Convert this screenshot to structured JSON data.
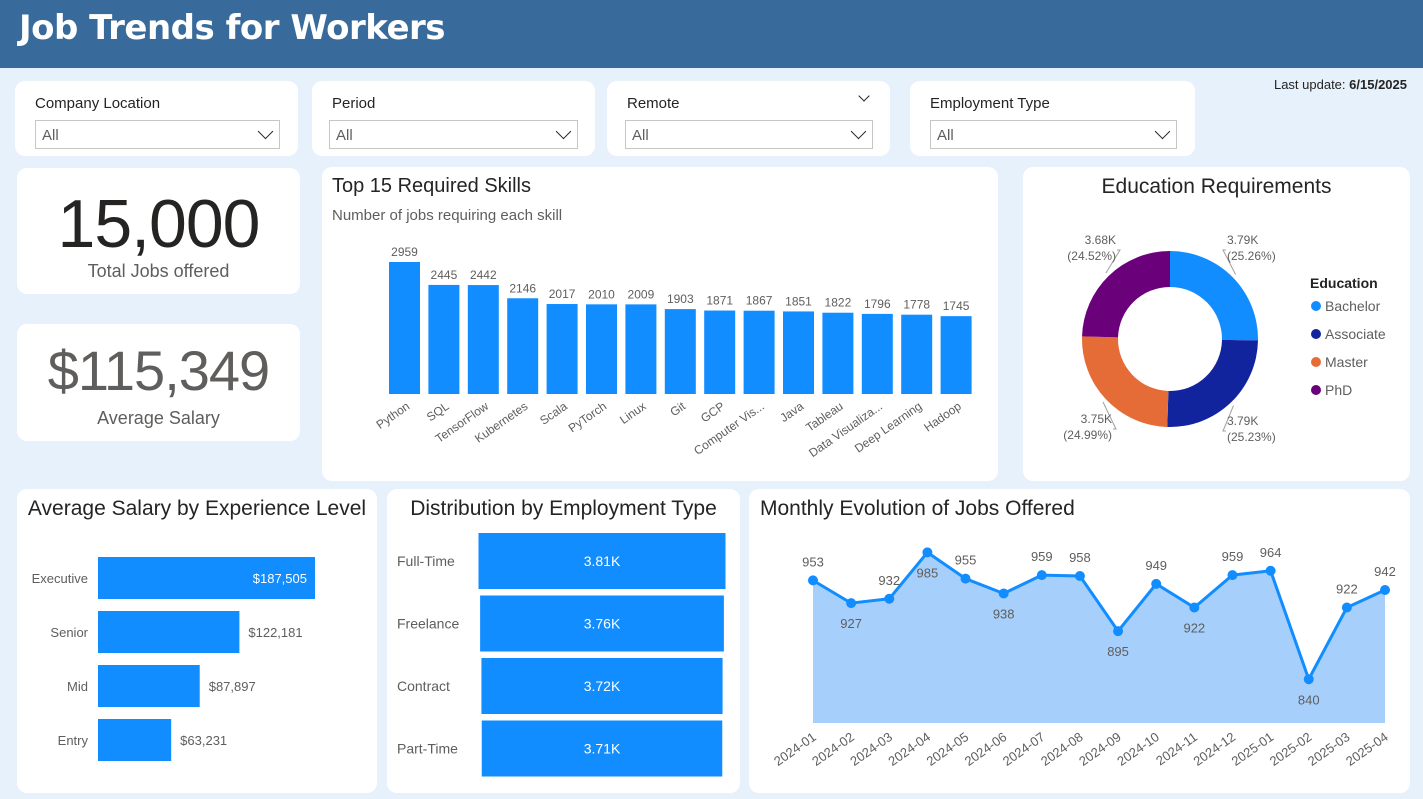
{
  "header": {
    "title": "Job Trends for Workers"
  },
  "last_update": {
    "label": "Last update:",
    "value": "6/15/2025"
  },
  "slicers": [
    {
      "title": "Company Location",
      "value": "All"
    },
    {
      "title": "Period",
      "value": "All"
    },
    {
      "title": "Remote",
      "value": "All"
    },
    {
      "title": "Employment Type",
      "value": "All"
    }
  ],
  "kpis": {
    "total_jobs": {
      "value": "15,000",
      "label": "Total Jobs offered"
    },
    "avg_salary": {
      "value": "$115,349",
      "label": "Average Salary"
    }
  },
  "skills_chart": {
    "title": "Top 15 Required Skills",
    "subtitle": "Number of jobs requiring each skill"
  },
  "education_chart": {
    "title": "Education Requirements",
    "legend_title": "Education"
  },
  "experience_chart": {
    "title": "Average Salary by Experience Level"
  },
  "employment_chart": {
    "title": "Distribution by Employment Type"
  },
  "monthly_chart": {
    "title": "Monthly Evolution of Jobs Offered"
  },
  "colors": {
    "header": "#386b9b",
    "accent": "#118dff",
    "area": "#a6cffb",
    "associate": "#12239e",
    "master": "#e66c37",
    "phd": "#6b007b"
  },
  "chart_data": [
    {
      "type": "bar",
      "title": "Top 15 Required Skills",
      "subtitle": "Number of jobs requiring each skill",
      "categories": [
        "Python",
        "SQL",
        "TensorFlow",
        "Kubernetes",
        "Scala",
        "PyTorch",
        "Linux",
        "Git",
        "GCP",
        "Computer Vis...",
        "Java",
        "Tableau",
        "Data Visualiza...",
        "Deep Learning",
        "Hadoop"
      ],
      "values": [
        2959,
        2445,
        2442,
        2146,
        2017,
        2010,
        2009,
        1903,
        1871,
        1867,
        1851,
        1822,
        1796,
        1778,
        1745
      ],
      "data_labels": [
        "2959",
        "2445",
        "2442",
        "2146",
        "2017",
        "2010",
        "2009",
        "1903",
        "1871",
        "1867",
        "1851",
        "1822",
        "1796",
        "1778",
        "1745"
      ],
      "ylim": [
        0,
        3000
      ]
    },
    {
      "type": "pie",
      "title": "Education Requirements",
      "legend_title": "Education",
      "legend_position": "right",
      "categories": [
        "Bachelor",
        "Associate",
        "Master",
        "PhD"
      ],
      "values": [
        3790,
        3785,
        3749,
        3678
      ],
      "percents": [
        25.26,
        25.23,
        24.99,
        24.52
      ],
      "labels": [
        [
          "3.79K",
          "(25.26%)"
        ],
        [
          "3.79K",
          "(25.23%)"
        ],
        [
          "3.75K",
          "(24.99%)"
        ],
        [
          "3.68K",
          "(24.52%)"
        ]
      ],
      "colors": [
        "#118dff",
        "#12239e",
        "#e66c37",
        "#6b007b"
      ]
    },
    {
      "type": "bar",
      "orientation": "horizontal",
      "title": "Average Salary by Experience Level",
      "categories": [
        "Executive",
        "Senior",
        "Mid",
        "Entry"
      ],
      "values": [
        187505,
        122181,
        87897,
        63231
      ],
      "data_labels": [
        "$187,505",
        "$122,181",
        "$87,897",
        "$63,231"
      ],
      "xlim": [
        0,
        190000
      ]
    },
    {
      "type": "bar",
      "orientation": "horizontal",
      "title": "Distribution by Employment Type",
      "categories": [
        "Full-Time",
        "Freelance",
        "Contract",
        "Part-Time"
      ],
      "values": [
        3810,
        3760,
        3720,
        3710
      ],
      "data_labels": [
        "3.81K",
        "3.76K",
        "3.72K",
        "3.71K"
      ]
    },
    {
      "type": "area",
      "title": "Monthly Evolution of Jobs Offered",
      "x": [
        "2024-01",
        "2024-02",
        "2024-03",
        "2024-04",
        "2024-05",
        "2024-06",
        "2024-07",
        "2024-08",
        "2024-09",
        "2024-10",
        "2024-11",
        "2024-12",
        "2025-01",
        "2025-02",
        "2025-03",
        "2025-04"
      ],
      "values": [
        953,
        927,
        932,
        985,
        955,
        938,
        959,
        958,
        895,
        949,
        922,
        959,
        964,
        840,
        922,
        942
      ],
      "label_position": [
        "above",
        "below",
        "above",
        "below",
        "above",
        "below",
        "above",
        "above",
        "below",
        "above",
        "below",
        "above",
        "above",
        "below",
        "above",
        "above"
      ],
      "ylim": [
        790,
        990
      ]
    }
  ]
}
